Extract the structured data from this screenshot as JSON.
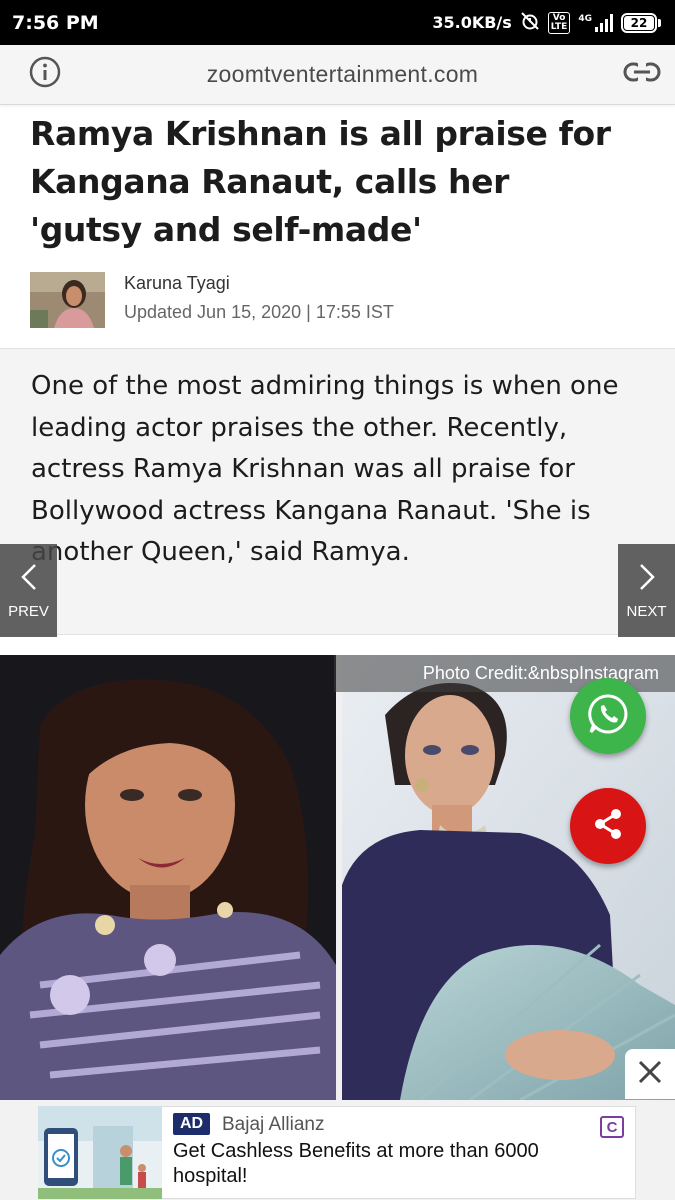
{
  "status_bar": {
    "time": "7:56 PM",
    "network_speed": "35.0KB/s",
    "volte": "Vo\nLTE",
    "network_type": "4G",
    "battery": "22"
  },
  "url_bar": {
    "url": "zoomtventertainment.com",
    "info_icon": "info-icon",
    "link_icon": "link-icon"
  },
  "article": {
    "headline": "Ramya Krishnan is all praise for Kangana Ranaut, calls her 'gutsy and self-made'",
    "author": "Karuna Tyagi",
    "updated": "Updated Jun 15, 2020 | 17:55 IST",
    "intro": "One of the most admiring things is when one leading actor praises the other. Recently, actress Ramya Krishnan was all praise for Bollywood actress Kangana Ranaut. 'She is another Queen,' said Ramya.",
    "photo_credit": "Photo Credit:&nbspInstagram"
  },
  "navigation": {
    "prev_label": "PREV",
    "next_label": "NEXT"
  },
  "ad": {
    "badge": "AD",
    "advertiser": "Bajaj Allianz",
    "headline": "Get Cashless Benefits at more than 6000 hospital!",
    "choice_icon": "adchoices-icon",
    "close_icon": "close-icon"
  },
  "colors": {
    "whatsapp": "#3db54a",
    "share": "#d81414",
    "ad_badge": "#1d2c6b"
  }
}
